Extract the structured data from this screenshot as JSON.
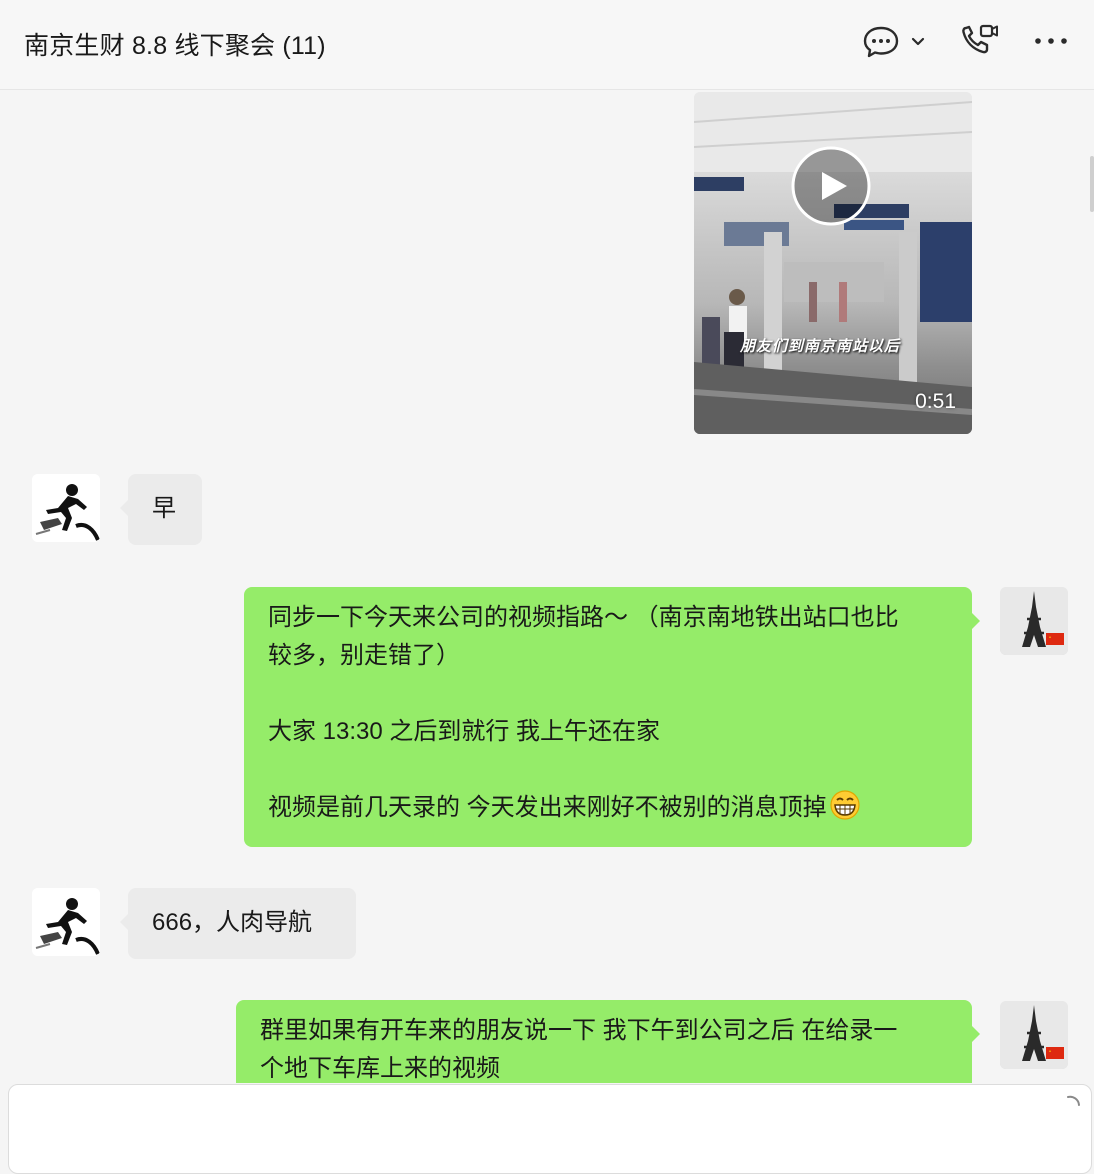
{
  "header": {
    "title": "南京生财 8.8 线下聚会 (11)",
    "icons": [
      "chat-bubble-icon",
      "chevron-down-icon",
      "phone-video-icon",
      "more-icon"
    ]
  },
  "video_message": {
    "caption": "朋友们到南京南站以后",
    "duration": "0:51"
  },
  "messages": [
    {
      "from": "other",
      "lines": [
        "早"
      ]
    },
    {
      "from": "me",
      "lines": [
        "同步一下今天来公司的视频指路～ （南京南地铁出站口也比",
        "较多，别走错了）",
        "",
        "大家 13:30 之后到就行 我上午还在家",
        "",
        "视频是前几天录的 今天发出来刚好不被别的消息顶掉"
      ]
    },
    {
      "from": "other",
      "lines": [
        "666，人肉导航"
      ]
    },
    {
      "from": "me",
      "lines": [
        "群里如果有开车来的朋友说一下 我下午到公司之后 在给录一",
        "个地下车库上来的视频"
      ]
    }
  ],
  "colors": {
    "my_bubble": "#95ec69",
    "their_bubble": "#ebebeb",
    "background": "#f5f5f5"
  }
}
